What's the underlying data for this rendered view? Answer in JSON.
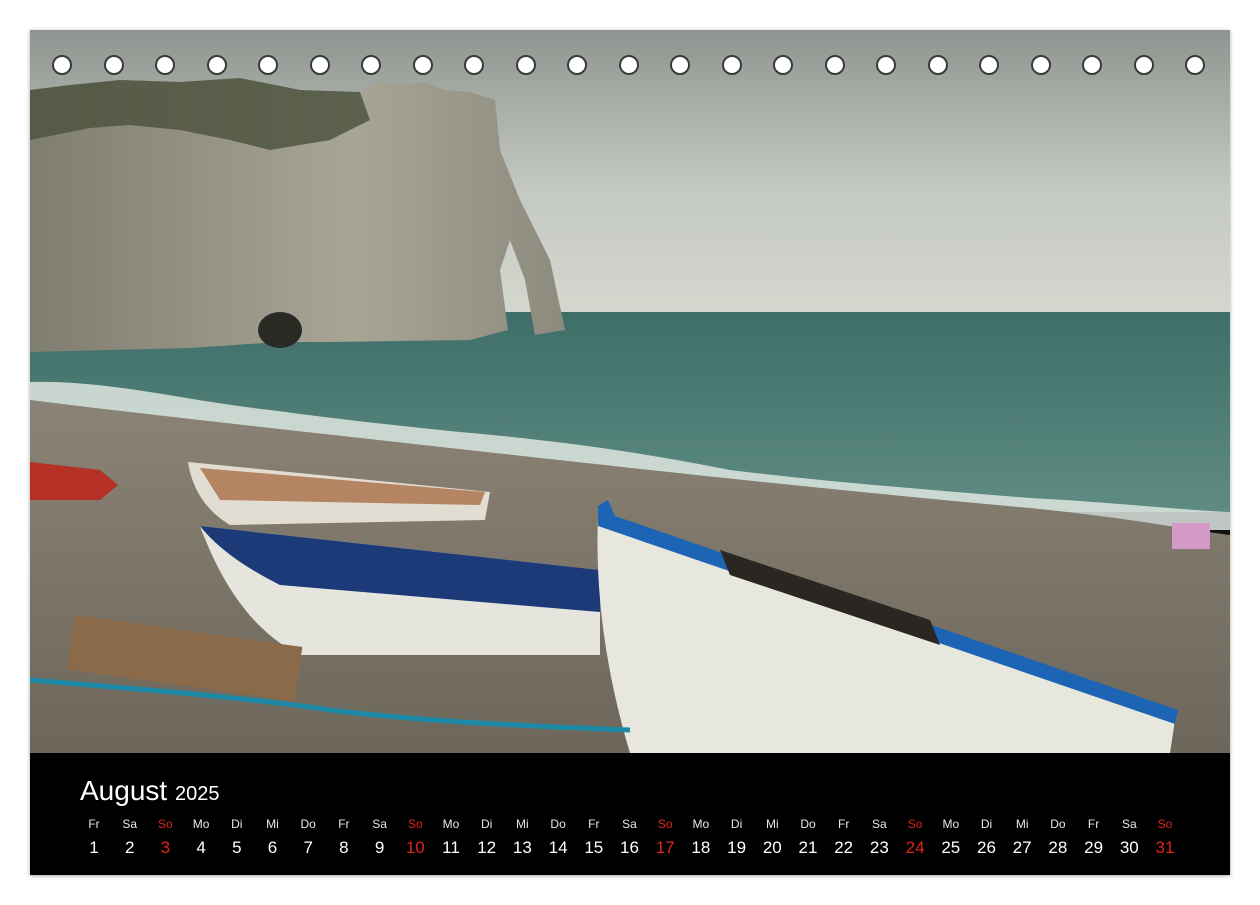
{
  "calendar": {
    "month": "August",
    "year": "2025",
    "sunday_color": "#e0241b",
    "days": [
      {
        "wd": "Fr",
        "d": "1"
      },
      {
        "wd": "Sa",
        "d": "2"
      },
      {
        "wd": "So",
        "d": "3",
        "sunday": true
      },
      {
        "wd": "Mo",
        "d": "4"
      },
      {
        "wd": "Di",
        "d": "5"
      },
      {
        "wd": "Mi",
        "d": "6"
      },
      {
        "wd": "Do",
        "d": "7"
      },
      {
        "wd": "Fr",
        "d": "8"
      },
      {
        "wd": "Sa",
        "d": "9"
      },
      {
        "wd": "So",
        "d": "10",
        "sunday": true
      },
      {
        "wd": "Mo",
        "d": "11"
      },
      {
        "wd": "Di",
        "d": "12"
      },
      {
        "wd": "Mi",
        "d": "13"
      },
      {
        "wd": "Do",
        "d": "14"
      },
      {
        "wd": "Fr",
        "d": "15"
      },
      {
        "wd": "Sa",
        "d": "16"
      },
      {
        "wd": "So",
        "d": "17",
        "sunday": true
      },
      {
        "wd": "Mo",
        "d": "18"
      },
      {
        "wd": "Di",
        "d": "19"
      },
      {
        "wd": "Mi",
        "d": "20"
      },
      {
        "wd": "Do",
        "d": "21"
      },
      {
        "wd": "Fr",
        "d": "22"
      },
      {
        "wd": "Sa",
        "d": "23"
      },
      {
        "wd": "So",
        "d": "24",
        "sunday": true
      },
      {
        "wd": "Mo",
        "d": "25"
      },
      {
        "wd": "Di",
        "d": "26"
      },
      {
        "wd": "Mi",
        "d": "27"
      },
      {
        "wd": "Do",
        "d": "28"
      },
      {
        "wd": "Fr",
        "d": "29"
      },
      {
        "wd": "Sa",
        "d": "30"
      },
      {
        "wd": "So",
        "d": "31",
        "sunday": true
      }
    ]
  },
  "photo": {
    "subject": "chalk-cliff-arch-beach-boats",
    "colors": {
      "sky": "#c9cec6",
      "sea": "#4f7f77",
      "cliff": "#9a988a",
      "pebbles": "#8f8779",
      "boat_blue": "#1e64b4"
    }
  }
}
